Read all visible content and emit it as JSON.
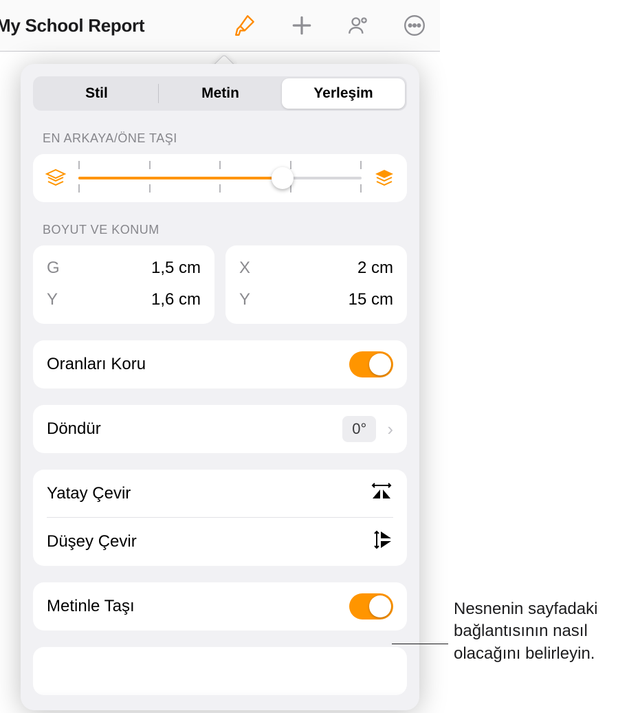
{
  "toolbar": {
    "title": "My School Report"
  },
  "tabs": {
    "style": "Stil",
    "text": "Metin",
    "layout": "Yerleşim"
  },
  "sections": {
    "layer": "EN ARKAYA/ÖNE TAŞI",
    "size_pos": "BOYUT VE KONUM"
  },
  "size_pos": {
    "w_label": "G",
    "w_value": "1,5 cm",
    "h_label": "Y",
    "h_value": "1,6 cm",
    "x_label": "X",
    "x_value": "2 cm",
    "y_label": "Y",
    "y_value": "15 cm"
  },
  "rows": {
    "constrain": "Oranları Koru",
    "rotate": "Döndür",
    "rotate_value": "0°",
    "flip_h": "Yatay Çevir",
    "flip_v": "Düşey Çevir",
    "move_with_text": "Metinle Taşı"
  },
  "callout": "Nesnenin sayfadaki bağlantısının nasıl olacağını belirleyin."
}
